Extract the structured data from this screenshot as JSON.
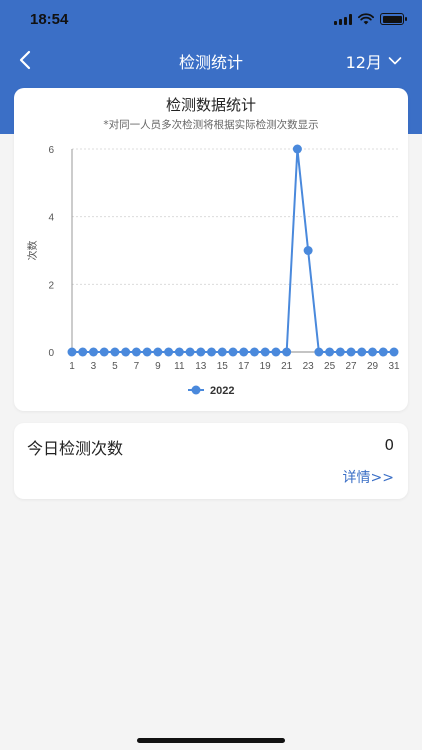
{
  "status_bar": {
    "time": "18:54"
  },
  "nav": {
    "title": "检测统计",
    "month": "12月"
  },
  "chart_card": {
    "title": "检测数据统计",
    "subtitle": "*对同一人员多次检测将根据实际检测次数显示"
  },
  "chart_data": {
    "type": "line",
    "title": "检测数据统计",
    "subtitle": "*对同一人员多次检测将根据实际检测次数显示",
    "xlabel": "",
    "ylabel": "次数",
    "x": [
      1,
      2,
      3,
      4,
      5,
      6,
      7,
      8,
      9,
      10,
      11,
      12,
      13,
      14,
      15,
      16,
      17,
      18,
      19,
      20,
      21,
      22,
      23,
      24,
      25,
      26,
      27,
      28,
      29,
      30,
      31
    ],
    "x_tick_labels": [
      "1",
      "3",
      "5",
      "7",
      "9",
      "11",
      "13",
      "15",
      "17",
      "19",
      "21",
      "23",
      "25",
      "27",
      "29",
      "31"
    ],
    "y_ticks": [
      0,
      2,
      4,
      6
    ],
    "ylim": [
      0,
      6
    ],
    "grid": true,
    "legend_position": "bottom",
    "series": [
      {
        "name": "2022",
        "color": "#4a89dc",
        "values": [
          0,
          0,
          0,
          0,
          0,
          0,
          0,
          0,
          0,
          0,
          0,
          0,
          0,
          0,
          0,
          0,
          0,
          0,
          0,
          0,
          0,
          6,
          3,
          0,
          0,
          0,
          0,
          0,
          0,
          0,
          0
        ]
      }
    ]
  },
  "today_card": {
    "label": "今日检测次数",
    "count": "0",
    "details_link": "详情>>"
  },
  "colors": {
    "brand": "#3b6fc6",
    "series": "#4a89dc"
  }
}
